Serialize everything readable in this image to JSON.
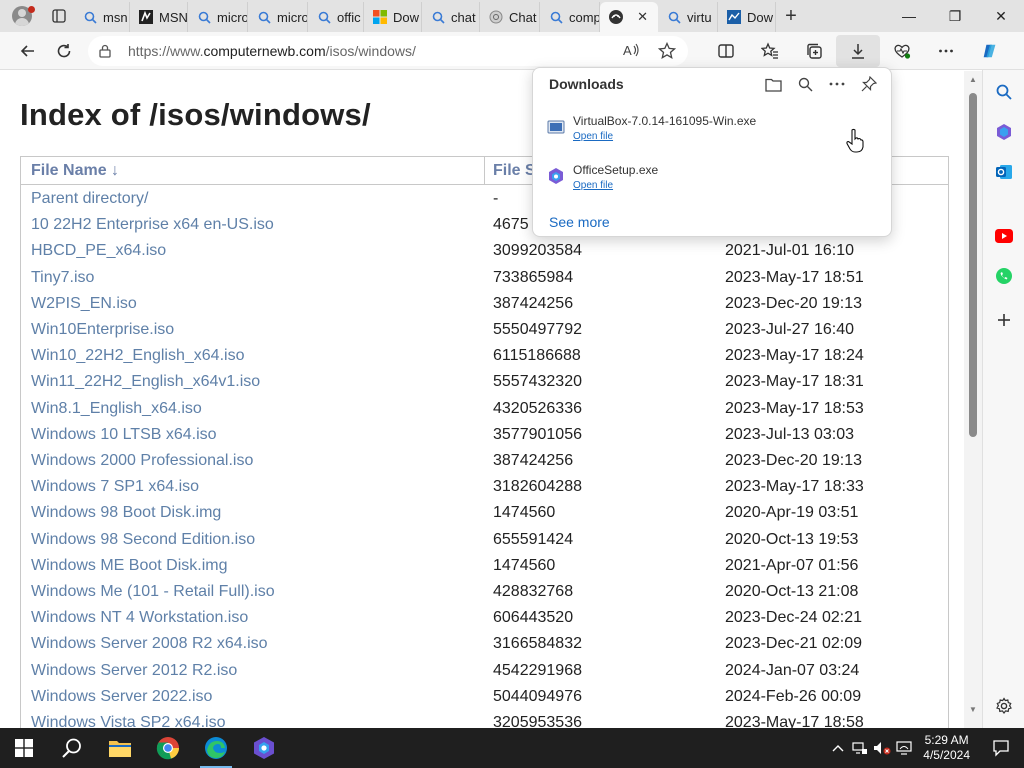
{
  "tabs": [
    {
      "label": "msn",
      "icon": "search-icon"
    },
    {
      "label": "MSN",
      "icon": "msn-icon"
    },
    {
      "label": "micro",
      "icon": "search-icon"
    },
    {
      "label": "micro",
      "icon": "search-icon"
    },
    {
      "label": "offic",
      "icon": "search-icon"
    },
    {
      "label": "Dow",
      "icon": "microsoft-icon"
    },
    {
      "label": "chat",
      "icon": "search-icon"
    },
    {
      "label": "Chat",
      "icon": "chatgpt-icon"
    },
    {
      "label": "comp",
      "icon": "search-icon"
    },
    {
      "label": "",
      "icon": "computernewb-icon",
      "active": true,
      "close": "✕"
    },
    {
      "label": "virtu",
      "icon": "search-icon"
    },
    {
      "label": "Dow",
      "icon": "virtualbox-icon"
    }
  ],
  "address": {
    "url_prefix": "https://www.",
    "url_domain": "computernewb.com",
    "url_path": "/isos/windows/"
  },
  "page": {
    "title": "Index of /isos/windows/",
    "columns": {
      "name": "File Name  ↓",
      "size": "File S",
      "date": ""
    },
    "rows": [
      {
        "name": "Parent directory/",
        "size": "-",
        "date": ""
      },
      {
        "name": "10 22H2 Enterprise x64 en-US.iso",
        "size": "4675",
        "date": ""
      },
      {
        "name": "HBCD_PE_x64.iso",
        "size": "3099203584",
        "date": "2021-Jul-01 16:10"
      },
      {
        "name": "Tiny7.iso",
        "size": "733865984",
        "date": "2023-May-17 18:51"
      },
      {
        "name": "W2PIS_EN.iso",
        "size": "387424256",
        "date": "2023-Dec-20 19:13"
      },
      {
        "name": "Win10Enterprise.iso",
        "size": "5550497792",
        "date": "2023-Jul-27 16:40"
      },
      {
        "name": "Win10_22H2_English_x64.iso",
        "size": "6115186688",
        "date": "2023-May-17 18:24"
      },
      {
        "name": "Win11_22H2_English_x64v1.iso",
        "size": "5557432320",
        "date": "2023-May-17 18:31"
      },
      {
        "name": "Win8.1_English_x64.iso",
        "size": "4320526336",
        "date": "2023-May-17 18:53"
      },
      {
        "name": "Windows 10 LTSB x64.iso",
        "size": "3577901056",
        "date": "2023-Jul-13 03:03"
      },
      {
        "name": "Windows 2000 Professional.iso",
        "size": "387424256",
        "date": "2023-Dec-20 19:13"
      },
      {
        "name": "Windows 7 SP1 x64.iso",
        "size": "3182604288",
        "date": "2023-May-17 18:33"
      },
      {
        "name": "Windows 98 Boot Disk.img",
        "size": "1474560",
        "date": "2020-Apr-19 03:51"
      },
      {
        "name": "Windows 98 Second Edition.iso",
        "size": "655591424",
        "date": "2020-Oct-13 19:53"
      },
      {
        "name": "Windows ME Boot Disk.img",
        "size": "1474560",
        "date": "2021-Apr-07 01:56"
      },
      {
        "name": "Windows Me (101 - Retail Full).iso",
        "size": "428832768",
        "date": "2020-Oct-13 21:08"
      },
      {
        "name": "Windows NT 4 Workstation.iso",
        "size": "606443520",
        "date": "2023-Dec-24 02:21"
      },
      {
        "name": "Windows Server 2008 R2 x64.iso",
        "size": "3166584832",
        "date": "2023-Dec-21 02:09"
      },
      {
        "name": "Windows Server 2012 R2.iso",
        "size": "4542291968",
        "date": "2024-Jan-07 03:24"
      },
      {
        "name": "Windows Server 2022.iso",
        "size": "5044094976",
        "date": "2024-Feb-26 00:09"
      },
      {
        "name": "Windows Vista SP2 x64.iso",
        "size": "3205953536",
        "date": "2023-May-17 18:58"
      }
    ]
  },
  "downloads": {
    "title": "Downloads",
    "items": [
      {
        "filename": "VirtualBox-7.0.14-161095-Win.exe",
        "action": "Open file"
      },
      {
        "filename": "OfficeSetup.exe",
        "action": "Open file"
      }
    ],
    "see_more": "See more"
  },
  "taskbar": {
    "time": "5:29 AM",
    "date": "4/5/2024"
  },
  "colors": {
    "link": "#5f80a8",
    "accent": "#1a6ac2",
    "taskbar": "#1f1f1f"
  }
}
